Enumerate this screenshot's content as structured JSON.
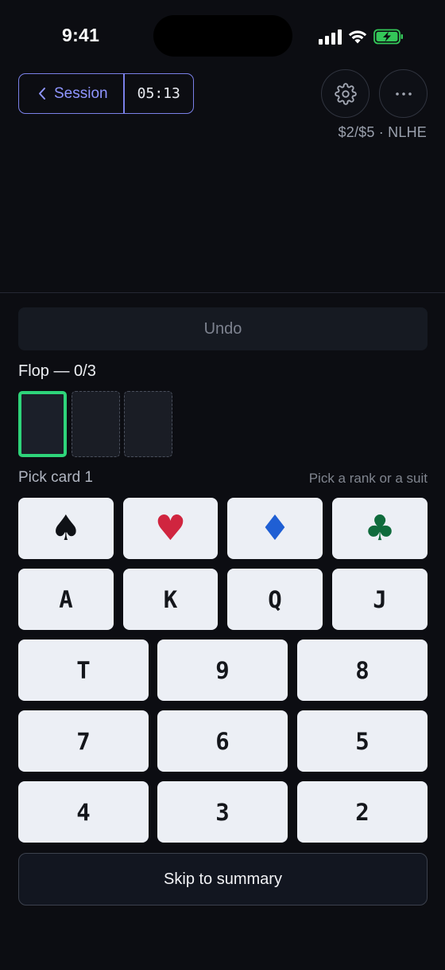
{
  "status_bar": {
    "time": "9:41"
  },
  "header": {
    "back_label": "Session",
    "timer": "05:13",
    "stakes": "$2/$5 · NLHE"
  },
  "undo_label": "Undo",
  "flop": {
    "label": "Flop — 0/3",
    "selected": 0,
    "total": 3
  },
  "picker": {
    "prompt": "Pick card 1",
    "hint": "Pick a rank or a suit",
    "suits": [
      {
        "symbol": "♠",
        "name": "spade",
        "color": "#0f1116"
      },
      {
        "symbol": "♥",
        "name": "heart",
        "color": "#d0253f"
      },
      {
        "symbol": "♦",
        "name": "diamond",
        "color": "#1f5fd4"
      },
      {
        "symbol": "♣",
        "name": "club",
        "color": "#0f6b3c"
      }
    ],
    "ranks_row1": [
      "A",
      "K",
      "Q",
      "J"
    ],
    "ranks_grid": [
      "T",
      "9",
      "8",
      "7",
      "6",
      "5",
      "4",
      "3",
      "2"
    ]
  },
  "skip_label": "Skip to summary",
  "colors": {
    "accent": "#8f95ff",
    "active_slot": "#2ed47a",
    "battery": "#34c759"
  },
  "icons": {
    "back": "chevron-left-icon",
    "settings": "gear-icon",
    "more": "ellipsis-icon"
  }
}
